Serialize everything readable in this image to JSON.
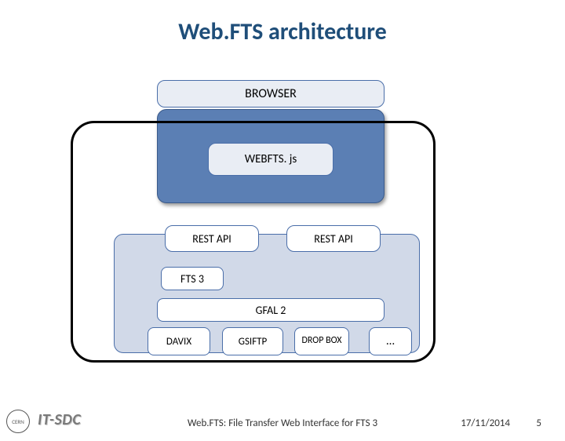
{
  "title": "Web.FTS architecture",
  "diagram": {
    "browser": "BROWSER",
    "webfts": "WEBFTS. js",
    "rest1": "REST API",
    "rest2": "REST API",
    "fts3": "FTS 3",
    "gfal2": "GFAL 2",
    "davix": "DAVIX",
    "gsiftp": "GSIFTP",
    "dropbox": "DROP BOX",
    "ellipsis": "…"
  },
  "footer": {
    "itsdc": "IT-SDC",
    "center": "Web.FTS:  File Transfer Web Interface for FTS 3",
    "date": "17/11/2014",
    "page": "5"
  }
}
